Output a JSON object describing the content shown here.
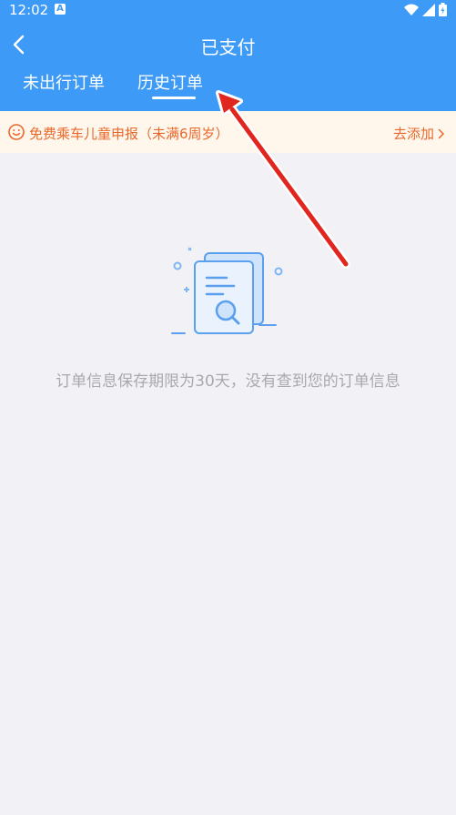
{
  "status_bar": {
    "time": "12:02",
    "badge": "A"
  },
  "header": {
    "title": "已支付",
    "tabs": [
      {
        "label": "未出行订单",
        "active": false
      },
      {
        "label": "历史订单",
        "active": true
      }
    ]
  },
  "banner": {
    "text": "免费乘车儿童申报（未满6周岁）",
    "action": "去添加"
  },
  "empty_state": {
    "message": "订单信息保存期限为30天，没有查到您的订单信息"
  },
  "colors": {
    "header": "#3d9bf7",
    "banner_bg": "#fff6ec",
    "accent_orange": "#e8692b",
    "annotation_arrow": "#e0261e",
    "background": "#f2f2f6"
  },
  "icons": [
    "back-arrow-icon",
    "smiley-icon",
    "chevron-right-icon",
    "document-search-icon",
    "wifi-icon",
    "signal-icon",
    "battery-icon"
  ]
}
